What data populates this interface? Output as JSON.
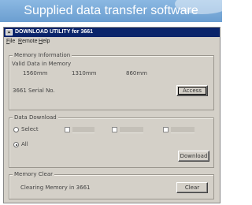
{
  "banner": {
    "title": "Supplied data transfer software"
  },
  "window": {
    "title": "DOWNLOAD UTILITY for 3661",
    "menu": [
      {
        "label": "File",
        "underline": "F",
        "rest": "ile"
      },
      {
        "label": "Remote",
        "underline": "R",
        "rest": "emote"
      },
      {
        "label": "Help",
        "underline": "H",
        "rest": "elp"
      }
    ]
  },
  "memory_information": {
    "title": "Memory Information",
    "valid_data_label": "Valid Data in Memory",
    "values": [
      "1560mm",
      "1310mm",
      "860mm"
    ],
    "serial_label": "3661 Serial No.",
    "access_button": "Access"
  },
  "data_download": {
    "title": "Data Download",
    "select_label": "Select",
    "all_label": "All",
    "selected": "All",
    "download_button": "Download"
  },
  "memory_clear": {
    "title": "Memory Clear",
    "status": "Clearing Memory in 3661",
    "clear_button": "Clear"
  }
}
